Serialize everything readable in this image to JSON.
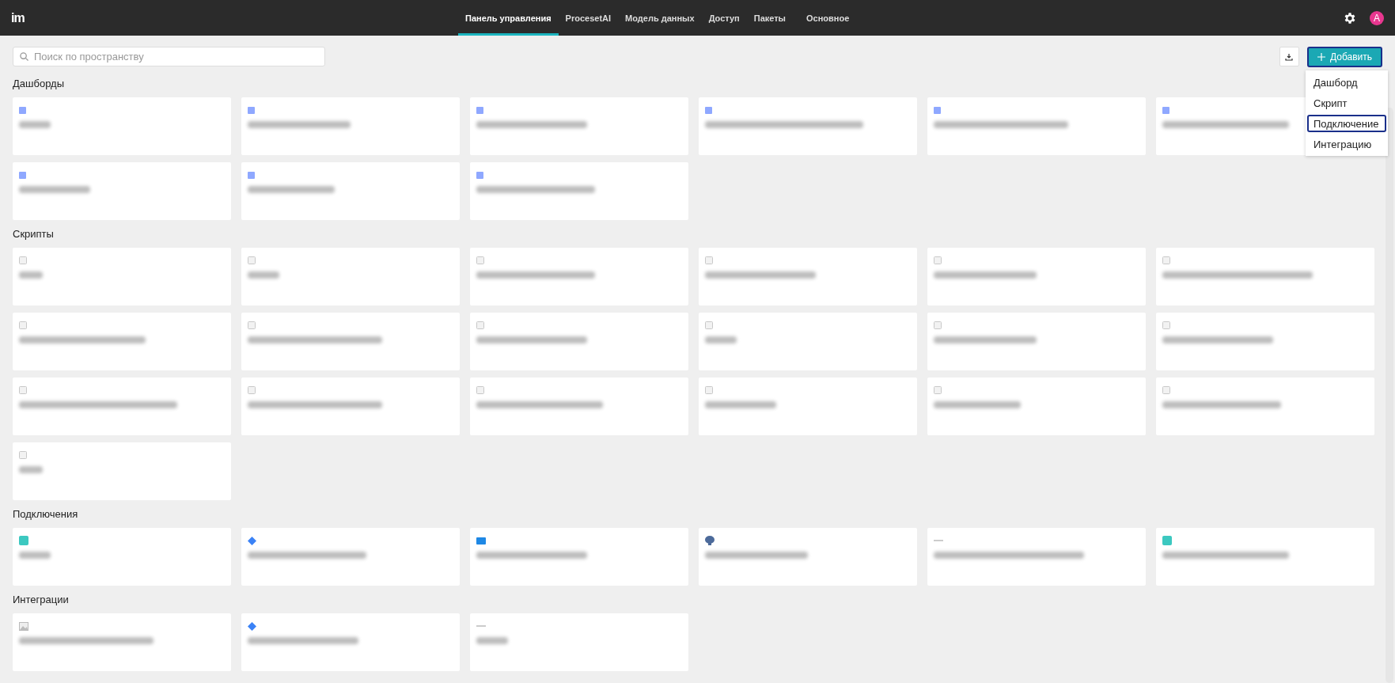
{
  "header": {
    "logo": "im",
    "tabs": [
      {
        "label": "Панель управления",
        "selected": true
      },
      {
        "label": "ProcesetAI",
        "selected": false
      },
      {
        "label": "Модель данных",
        "selected": false
      },
      {
        "label": "Доступ",
        "selected": false
      },
      {
        "label": "Пакеты",
        "selected": false
      },
      {
        "label": "Основное",
        "selected": false
      }
    ],
    "avatar": "A"
  },
  "toolbar": {
    "search": {
      "placeholder": "Поиск по пространству"
    },
    "add_button": "Добавить"
  },
  "add_menu": {
    "items": [
      {
        "label": "Дашборд",
        "selected": false
      },
      {
        "label": "Скрипт",
        "selected": false
      },
      {
        "label": "Подключение",
        "selected": true
      },
      {
        "label": "Интеграцию",
        "selected": false
      }
    ]
  },
  "sections": [
    {
      "title": "Дашборды",
      "cards": [
        {
          "kind": "dashboard"
        },
        {
          "kind": "dashboard"
        },
        {
          "kind": "dashboard"
        },
        {
          "kind": "dashboard"
        },
        {
          "kind": "dashboard"
        },
        {
          "kind": "dashboard"
        },
        {
          "kind": "dashboard"
        },
        {
          "kind": "dashboard"
        },
        {
          "kind": "dashboard"
        }
      ]
    },
    {
      "title": "Скрипты",
      "cards": [
        {
          "kind": "script"
        },
        {
          "kind": "script"
        },
        {
          "kind": "script"
        },
        {
          "kind": "script"
        },
        {
          "kind": "script"
        },
        {
          "kind": "script"
        },
        {
          "kind": "script"
        },
        {
          "kind": "script"
        },
        {
          "kind": "script"
        },
        {
          "kind": "script"
        },
        {
          "kind": "script"
        },
        {
          "kind": "script"
        },
        {
          "kind": "script"
        },
        {
          "kind": "script"
        },
        {
          "kind": "script"
        },
        {
          "kind": "script"
        },
        {
          "kind": "script"
        },
        {
          "kind": "script"
        },
        {
          "kind": "script"
        }
      ]
    },
    {
      "title": "Подключения",
      "cards": [
        {
          "kind": "teal"
        },
        {
          "kind": "jira"
        },
        {
          "kind": "mail"
        },
        {
          "kind": "database"
        },
        {
          "kind": "dash"
        },
        {
          "kind": "teal"
        }
      ]
    },
    {
      "title": "Интеграции",
      "cards": [
        {
          "kind": "image"
        },
        {
          "kind": "jira"
        },
        {
          "kind": "dash"
        }
      ]
    }
  ]
}
